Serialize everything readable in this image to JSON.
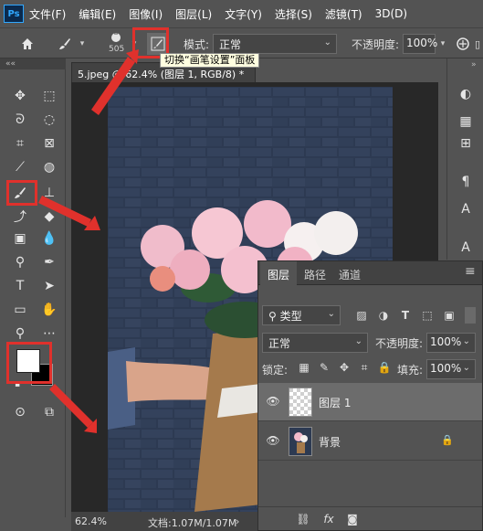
{
  "app": {
    "logo": "Ps"
  },
  "menu": [
    "文件(F)",
    "编辑(E)",
    "图像(I)",
    "图层(L)",
    "文字(Y)",
    "选择(S)",
    "滤镜(T)",
    "3D(D)"
  ],
  "options": {
    "brush_size": "505",
    "mode_label": "模式:",
    "mode_value": "正常",
    "opacity_label": "不透明度:",
    "opacity_value": "100%",
    "tooltip": "切换“画笔设置”面板"
  },
  "document": {
    "tab_label": "5.jpeg @ 62.4% (图层 1, RGB/8) *",
    "close": "×"
  },
  "toolbar": {
    "collapse": "««"
  },
  "right_strip": {
    "collapse": "»"
  },
  "layers_panel": {
    "tabs": [
      "图层",
      "路径",
      "通道"
    ],
    "filter_label": "类型",
    "blend_mode": "正常",
    "opacity_label": "不透明度:",
    "opacity_value": "100%",
    "lock_label": "锁定:",
    "fill_label": "填充:",
    "fill_value": "100%",
    "layers": [
      {
        "name": "图层 1",
        "selected": true
      },
      {
        "name": "背景",
        "selected": false,
        "locked": true
      }
    ],
    "footer_icons": [
      "link-icon",
      "fx-icon",
      "mask-icon"
    ],
    "footer_fx": "fx"
  },
  "status": {
    "zoom": "62.4%",
    "doc": "文档:1.07M/1.07M"
  },
  "colors": {
    "highlight": "#e0312c",
    "ui_bg": "#535353",
    "accent": "#31a8ff"
  }
}
